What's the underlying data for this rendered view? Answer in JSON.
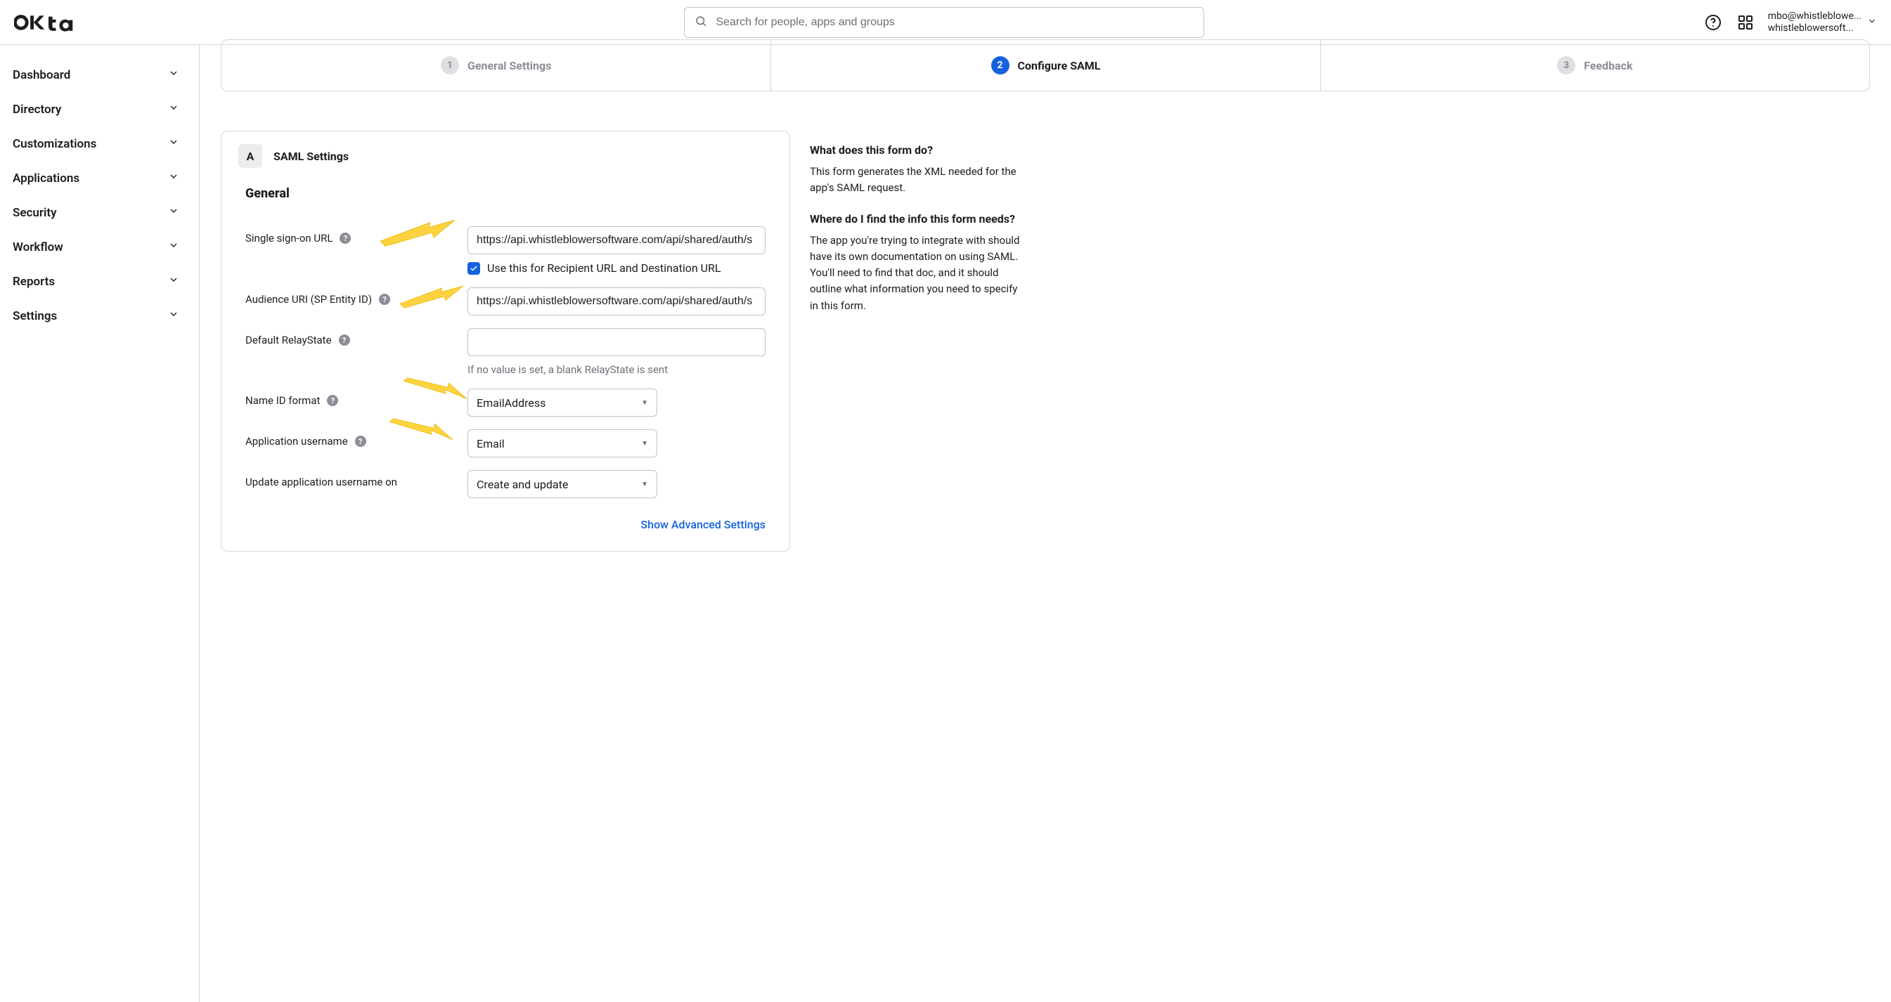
{
  "header": {
    "searchPlaceholder": "Search for people, apps and groups",
    "account": {
      "line1": "mbo@whistleblowe...",
      "line2": "whistleblowersoft..."
    }
  },
  "sidebar": {
    "items": [
      {
        "label": "Dashboard"
      },
      {
        "label": "Directory"
      },
      {
        "label": "Customizations"
      },
      {
        "label": "Applications"
      },
      {
        "label": "Security"
      },
      {
        "label": "Workflow"
      },
      {
        "label": "Reports"
      },
      {
        "label": "Settings"
      }
    ]
  },
  "stepper": {
    "steps": [
      {
        "num": "1",
        "label": "General Settings"
      },
      {
        "num": "2",
        "label": "Configure SAML"
      },
      {
        "num": "3",
        "label": "Feedback"
      }
    ]
  },
  "section": {
    "letter": "A",
    "title": "SAML Settings",
    "general": "General"
  },
  "form": {
    "ssoUrl": {
      "label": "Single sign-on URL",
      "value": "https://api.whistleblowersoftware.com/api/shared/auth/s",
      "useForRecipient": "Use this for Recipient URL and Destination URL"
    },
    "audience": {
      "label": "Audience URI (SP Entity ID)",
      "value": "https://api.whistleblowersoftware.com/api/shared/auth/s"
    },
    "relay": {
      "label": "Default RelayState",
      "value": "",
      "hint": "If no value is set, a blank RelayState is sent"
    },
    "nameId": {
      "label": "Name ID format",
      "value": "EmailAddress"
    },
    "appUser": {
      "label": "Application username",
      "value": "Email"
    },
    "updateOn": {
      "label": "Update application username on",
      "value": "Create and update"
    },
    "advanced": "Show Advanced Settings"
  },
  "aside": {
    "q1Title": "What does this form do?",
    "q1Body": "This form generates the XML needed for the app's SAML request.",
    "q2Title": "Where do I find the info this form needs?",
    "q2Body": "The app you're trying to integrate with should have its own documentation on using SAML. You'll need to find that doc, and it should outline what information you need to specify in this form."
  }
}
